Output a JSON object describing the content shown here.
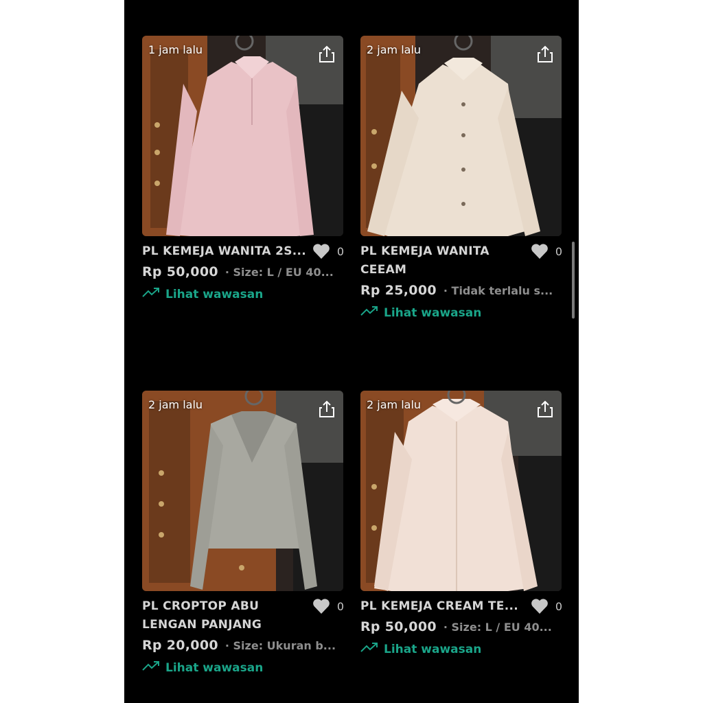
{
  "colors": {
    "background": "#000000",
    "accent": "#1aa589",
    "title_text": "#d6d6d6",
    "meta_text": "#8e8e8e"
  },
  "listings": [
    {
      "time": "1 jam lalu",
      "title": "PL KEMEJA WANITA 2S...",
      "likes": "0",
      "price": "Rp 50,000",
      "meta": "· Size: L / EU 40...",
      "insight": "Lihat wawasan",
      "icons": [
        "share-icon",
        "heart-icon",
        "trending-up-icon"
      ]
    },
    {
      "time": "2 jam lalu",
      "title": "PL KEMEJA WANITA CEEAM",
      "likes": "0",
      "price": "Rp 25,000",
      "meta": "· Tidak terlalu s...",
      "insight": "Lihat wawasan"
    },
    {
      "time": "2 jam lalu",
      "title": "PL CROPTOP ABU LENGAN PANJANG",
      "likes": "0",
      "price": "Rp 20,000",
      "meta": "· Size: Ukuran b...",
      "insight": "Lihat wawasan"
    },
    {
      "time": "2 jam lalu",
      "title": "PL KEMEJA CREAM TE...",
      "likes": "0",
      "price": "Rp 50,000",
      "meta": "· Size: L / EU 40...",
      "insight": "Lihat wawasan"
    }
  ]
}
